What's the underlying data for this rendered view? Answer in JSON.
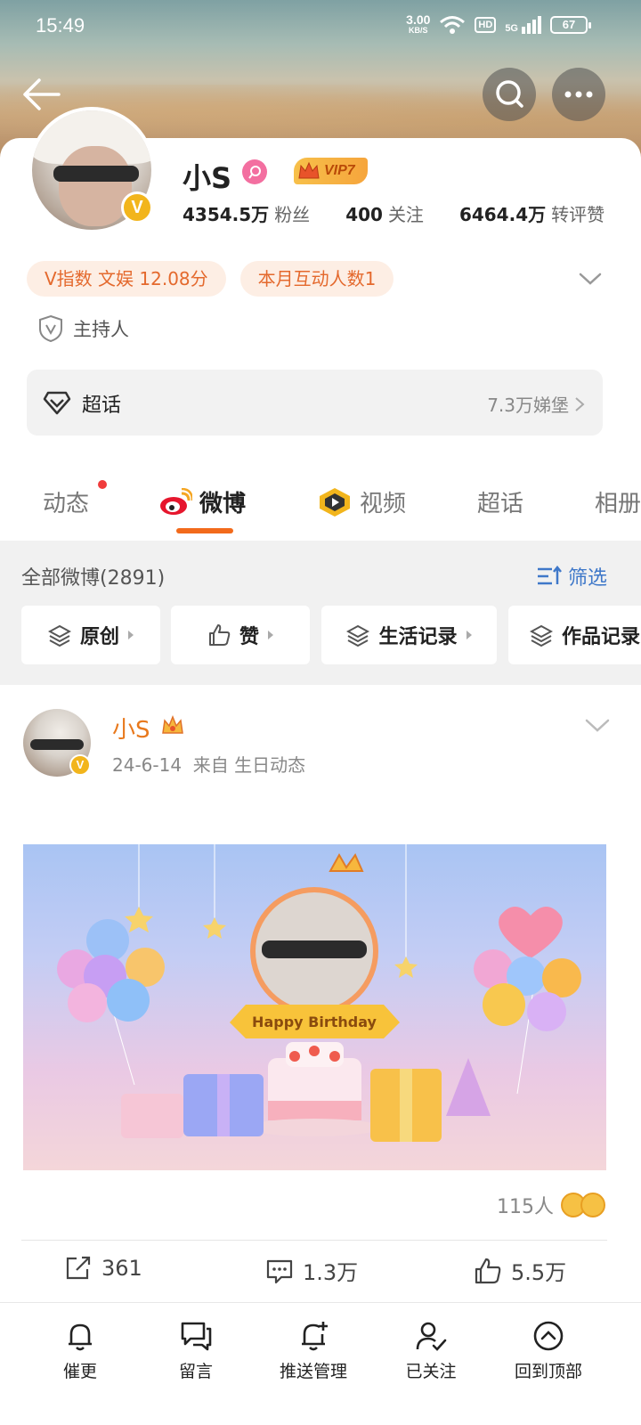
{
  "status_bar": {
    "time": "15:49",
    "net_speed_value": "3.00",
    "net_speed_unit": "KB/S",
    "hd": "HD",
    "signal": "5G",
    "battery": "67"
  },
  "header": {
    "back_icon": "arrow-left-icon",
    "search_icon": "search-icon",
    "more_icon": "more-dots-icon"
  },
  "profile": {
    "name": "小S",
    "verified_badge": "V",
    "vip_label": "VIP7",
    "stats": [
      {
        "value": "4354.5万",
        "label": "粉丝"
      },
      {
        "value": "400",
        "label": "关注"
      },
      {
        "value": "6464.4万",
        "label": "转评赞"
      }
    ],
    "chips": [
      "V指数 文娱 12.08分",
      "本月互动人数1"
    ],
    "role": "主持人",
    "supertopic": {
      "label": "超话",
      "right_text": "7.3万娣堡"
    }
  },
  "tabs": [
    {
      "label": "动态"
    },
    {
      "label": "微博"
    },
    {
      "label": "视频"
    },
    {
      "label": "超话"
    },
    {
      "label": "相册"
    }
  ],
  "filter": {
    "all_label": "全部微博(2891)",
    "screen_label": "筛选",
    "pills": [
      "原创",
      "赞",
      "生活记录",
      "作品记录"
    ]
  },
  "post": {
    "author": "小S",
    "verified_badge": "V",
    "meta": "24-6-14  来自 生日动态",
    "image_caption": "Happy Birthday",
    "reaction_count": "115人",
    "actions": [
      {
        "icon": "share-icon",
        "label": "361"
      },
      {
        "icon": "comment-icon",
        "label": "1.3万"
      },
      {
        "icon": "like-icon",
        "label": "5.5万"
      }
    ]
  },
  "bottom_bar": [
    {
      "icon": "bell-icon",
      "label": "催更"
    },
    {
      "icon": "message-icon",
      "label": "留言"
    },
    {
      "icon": "bell-plus-icon",
      "label": "推送管理"
    },
    {
      "icon": "user-check-icon",
      "label": "已关注"
    },
    {
      "icon": "chevron-up-circle-icon",
      "label": "回到顶部"
    }
  ],
  "colors": {
    "accent_orange": "#f26a1b",
    "link_blue": "#3f78c9",
    "badge_gold": "#f2b51c"
  }
}
